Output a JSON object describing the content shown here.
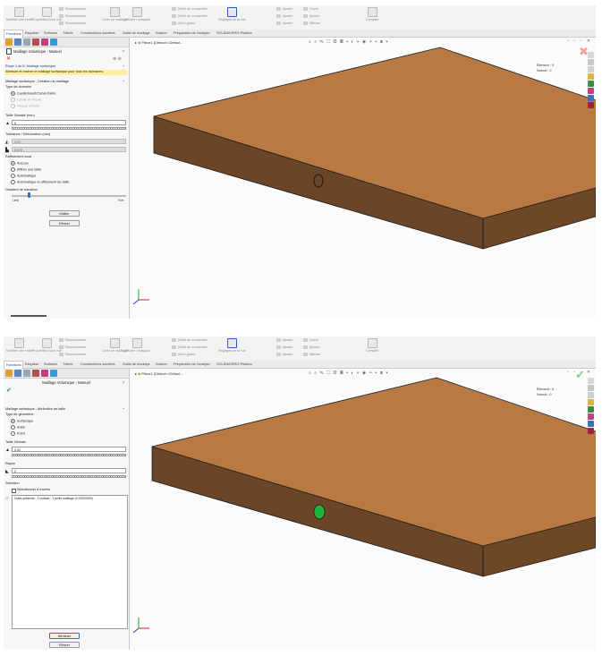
{
  "top": {
    "ribbon": {
      "btn1": "Modifier une entité",
      "btn2": "Propriétés d'une vue",
      "btn3": "Créer un maillage",
      "btn4": "Afficher / masquer",
      "stack1": [
        "Recouvrement",
        "Recouvrement",
        "Recouvrement"
      ],
      "stack2": [
        "Entité de la machine",
        "Entité de la machine",
        "Autre grand"
      ],
      "btn_large": "Réglages de la vue",
      "stack3": [
        "Ajuster",
        "Ajuster",
        "Ajuster"
      ],
      "stack4": [
        "Ouvrir",
        "Ajouter",
        "Afficher"
      ],
      "btn_end": "Compiler"
    },
    "tabs": [
      "Fonctions",
      "Esquisse",
      "Surfaces",
      "Tôlerie",
      "Constructions soudées",
      "Outils de moulage",
      "Evaluer",
      "Préparation de l'analyse",
      "SOLIDWORKS Plastics"
    ],
    "panel": {
      "title": "Maillage Volumique - Manuel",
      "step": "Étape 1 de 8: Maillage surfacique",
      "info": "Attribuer et insérer le maillage surfacique pour tous les domaines",
      "section1": "Maillage surfacique - Création du maillage",
      "domain_type": "Type de domaine",
      "radios1": [
        "Cavité/Insert/Canal d'alim.",
        "Cavité de moule",
        "Plaque d'insert"
      ],
      "size_label": "Taille Globale (mm)",
      "size_value": "5",
      "tolerance_label": "Tolérance / Déformation (mm)",
      "tol1": "0.01",
      "tol2": "0.075",
      "auto_label": "Raffinement local",
      "radios2": [
        "Aucune",
        "Affiner une taille",
        "Automatique",
        "Automatique et affinement de taille"
      ],
      "gradient_label": "Gradient de transition",
      "gradient_lo": "Lent",
      "gradient_hi": "Fort",
      "mesh_button": "Mailler",
      "delete_button": "Effacer"
    },
    "viewport": {
      "tree_label": "Pièce1 (Défaut<<Défaut...",
      "stats": [
        "Élément : 0",
        "Noeud : 0"
      ]
    }
  },
  "bottom": {
    "tabs": [
      "Fonctions",
      "Esquisse",
      "Surfaces",
      "Tôlerie",
      "Constructions soudées",
      "Outils de moulage",
      "Evaluer",
      "Préparation de l'analyse",
      "SOLIDWORKS Plastics"
    ],
    "panel": {
      "title": "Maillage Volumique - Manuel",
      "section1": "Maillage surfacique - Attribution de taille",
      "geom_type": "Type de géométrie",
      "radios1": [
        "Surfacique",
        "Arête",
        "Point"
      ],
      "size_label": "Taille Globale",
      "size_value": "0.02",
      "radius_label": "Rayon",
      "radius_value": "2",
      "selection_label": "Sélection",
      "checkbox": "Sélectionner à travers",
      "list_item": "Outils présents : 1 surface : 1 petits maillage (0.02000000)",
      "apply_button": "Attribuer",
      "delete_button": "Effacer"
    },
    "viewport": {
      "tree_label": "Pièce1 (Défaut<<Défaut...",
      "stats": [
        "Élément : 0",
        "Noeud : 0"
      ]
    }
  },
  "colors": {
    "slab_top": "#b87a42",
    "slab_front": "#6b4527",
    "slab_side": "#6e4826",
    "marker_green": "#22b33a",
    "accent_blue": "#1c3f8a",
    "info_yellow": "#ffef99"
  }
}
